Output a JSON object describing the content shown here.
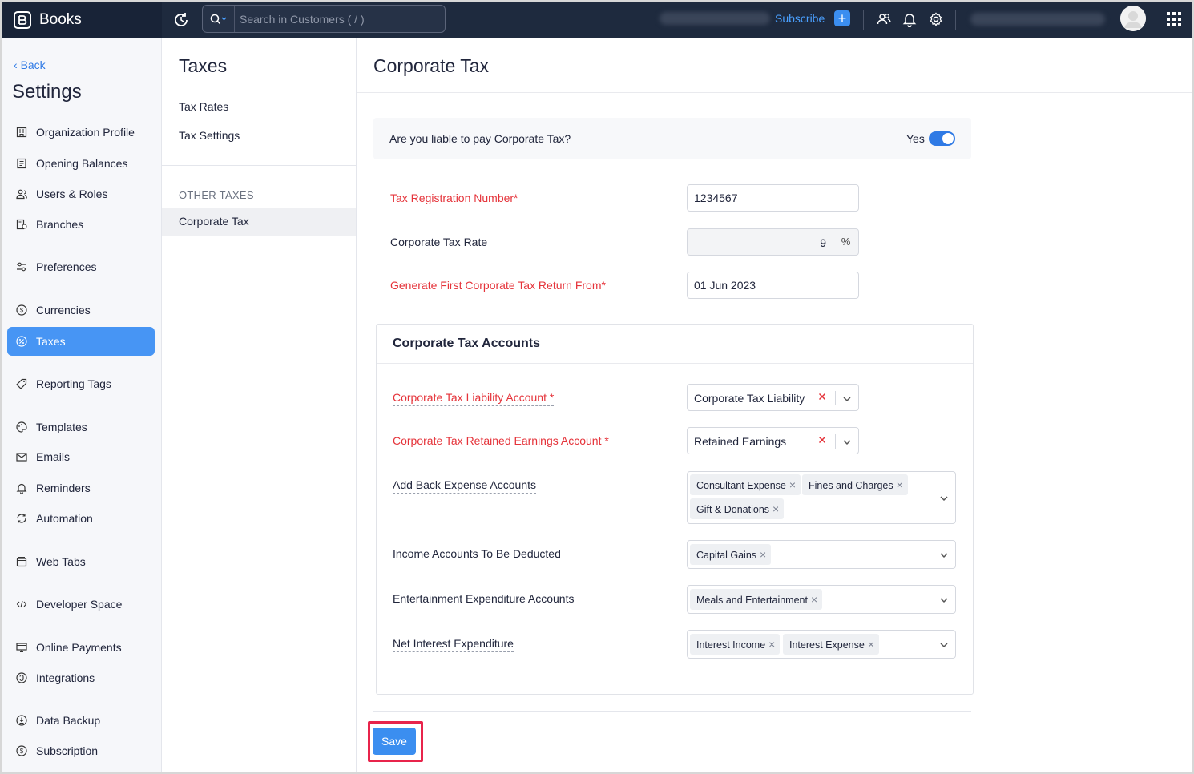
{
  "topbar": {
    "app_name": "Books",
    "search_placeholder": "Search in Customers ( / )",
    "subscribe_label": "Subscribe"
  },
  "sidebar": {
    "back_label": "Back",
    "title": "Settings",
    "items": [
      {
        "label": "Organization Profile",
        "icon": "building-icon"
      },
      {
        "label": "Opening Balances",
        "icon": "ledger-icon"
      },
      {
        "label": "Users & Roles",
        "icon": "users-icon"
      },
      {
        "label": "Branches",
        "icon": "branch-icon"
      },
      {
        "label": "Preferences",
        "icon": "preferences-icon"
      },
      {
        "label": "Currencies",
        "icon": "currency-icon"
      },
      {
        "label": "Taxes",
        "icon": "percent-icon",
        "active": true
      },
      {
        "label": "Reporting Tags",
        "icon": "tag-icon"
      },
      {
        "label": "Templates",
        "icon": "palette-icon"
      },
      {
        "label": "Emails",
        "icon": "mail-icon"
      },
      {
        "label": "Reminders",
        "icon": "bell-icon"
      },
      {
        "label": "Automation",
        "icon": "refresh-icon"
      },
      {
        "label": "Web Tabs",
        "icon": "tabs-icon"
      },
      {
        "label": "Developer Space",
        "icon": "code-icon"
      },
      {
        "label": "Online Payments",
        "icon": "payment-icon"
      },
      {
        "label": "Integrations",
        "icon": "integration-icon"
      },
      {
        "label": "Data Backup",
        "icon": "backup-icon"
      },
      {
        "label": "Subscription",
        "icon": "subscription-icon"
      }
    ]
  },
  "taxes": {
    "title": "Taxes",
    "links": [
      "Tax Rates",
      "Tax Settings"
    ],
    "section_heading": "OTHER TAXES",
    "active_item": "Corporate Tax"
  },
  "main": {
    "title": "Corporate Tax",
    "liable_question": "Are you liable to pay Corporate Tax?",
    "liable_value": "Yes",
    "fields": {
      "trn_label": "Tax Registration Number*",
      "trn_value": "1234567",
      "rate_label": "Corporate Tax Rate",
      "rate_value": "9",
      "rate_unit": "%",
      "first_return_label": "Generate First Corporate Tax Return From*",
      "first_return_value": "01 Jun 2023"
    },
    "accounts": {
      "title": "Corporate Tax Accounts",
      "liability_label": "Corporate Tax Liability Account *",
      "liability_value": "Corporate Tax Liability",
      "retained_label": "Corporate Tax Retained Earnings Account *",
      "retained_value": "Retained Earnings",
      "addback_label": "Add Back Expense Accounts",
      "addback_chips": [
        "Consultant Expense",
        "Fines and Charges",
        "Gift & Donations"
      ],
      "income_label": "Income Accounts To Be Deducted",
      "income_chips": [
        "Capital Gains"
      ],
      "entertainment_label": "Entertainment Expenditure Accounts",
      "entertainment_chips": [
        "Meals and Entertainment"
      ],
      "interest_label": "Net Interest Expenditure",
      "interest_chips": [
        "Interest Income",
        "Interest Expense"
      ]
    },
    "save_label": "Save"
  },
  "colors": {
    "topbar": "#1e2a3e",
    "accent": "#3b8ef0",
    "required": "#e5333a",
    "highlight": "#e8244b"
  }
}
